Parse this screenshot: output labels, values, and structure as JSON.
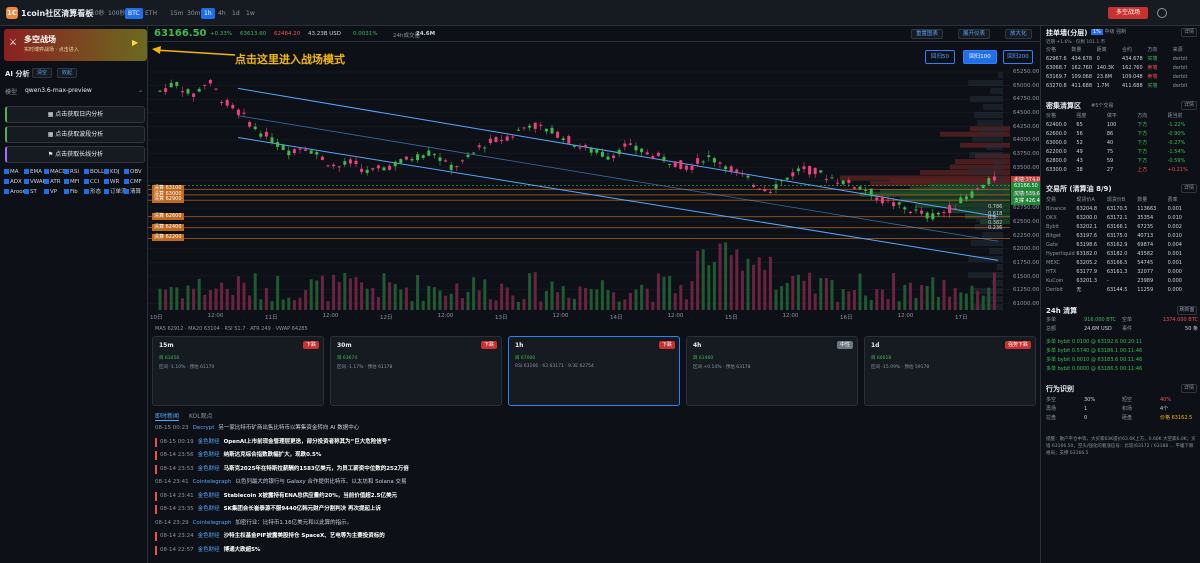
{
  "app": {
    "title": "1coin社区清算看板",
    "logo": "1C"
  },
  "topbar": {
    "tf": [
      "10秒",
      "100秒",
      "BTC",
      "ETH",
      "15m",
      "30m",
      "1h",
      "4h",
      "1d",
      "1w"
    ],
    "active": "BTC",
    "active2": "1h",
    "mode_label": "多空战场"
  },
  "left": {
    "battle_title": "多空战场",
    "battle_sub": "实时博弈战场 · 点击进入",
    "ai_title": "AI 分析",
    "clear": "清空",
    "collapse": "收起",
    "model_label": "模型",
    "model": "qwen3.6-max-preview",
    "actions": [
      "点击获取日内分析",
      "点击获取波段分析",
      "点击获取长线分析"
    ],
    "indicators": [
      "MA",
      "EMA",
      "MACD",
      "RSI",
      "BOLL",
      "KDJ",
      "OBV",
      "ADX",
      "VWAP",
      "ATR",
      "MFI",
      "CCI",
      "WR",
      "CMF",
      "Aroon",
      "ST",
      "VP",
      "Fib",
      "形态",
      "订单流",
      "清算"
    ]
  },
  "price": {
    "last": "63166.50",
    "change": "+0.33%",
    "high": "63613.60",
    "low": "62484.20",
    "vol": "43.23B USD",
    "funding": "0.0031%",
    "oi_label": "24h成交量",
    "oi": "24.6M",
    "btn_reset": "重置图表",
    "btn_expand": "展开仪表",
    "btn_full": "放大化"
  },
  "chart": {
    "annotation": "点击这里进入战场模式",
    "lookback": [
      "回归50",
      "回归100",
      "回归200"
    ],
    "lookback_active": "回归100",
    "y_ticks": [
      "65250.00",
      "65000.00",
      "64750.00",
      "64500.00",
      "64250.00",
      "64000.00",
      "63750.00",
      "63500.00",
      "63250.00",
      "63000.00",
      "62750.00",
      "62500.00",
      "62250.00",
      "62000.00",
      "61750.00",
      "61500.00",
      "61250.00",
      "61000.00"
    ],
    "x_ticks": [
      "10日",
      "12:00",
      "11日",
      "12:00",
      "12日",
      "12:00",
      "13日",
      "12:00",
      "14日",
      "12:00",
      "15日",
      "12:00",
      "16日",
      "12:00",
      "17日"
    ],
    "levels": [
      "清算 63100",
      "清算 63000",
      "清算 62900",
      "清算 62600",
      "清算 62400",
      "清算 62200"
    ],
    "right_labels": [
      {
        "t": "卖墙 374.068",
        "c": "#c93030"
      },
      {
        "t": "63166.50",
        "c": "#238636"
      },
      {
        "t": "买墙 539.638",
        "c": "#238636"
      },
      {
        "t": "支撑 426.498",
        "c": "#238636"
      }
    ],
    "fib": [
      "0.786",
      "0.618",
      "0.5",
      "0.382",
      "0.236"
    ]
  },
  "ind_line": "MA5 62912 · MA20 63104 · RSI 51.7 · ATR 249 · VWAP 64285",
  "tf_cards": [
    {
      "n": "15m",
      "badge": "下跌",
      "bc": "#c93030",
      "l1": "目 63450",
      "l2": "区间 -1.10% · 预估 61170"
    },
    {
      "n": "30m",
      "badge": "下跌",
      "bc": "#c93030",
      "l1": "目 63674",
      "l2": "区间 -1.17% · 预估 61178"
    },
    {
      "n": "1h",
      "badge": "下跌",
      "bc": "#c93030",
      "l1": "目 67000",
      "l2": "RSI 63166 · 63 63171 · 9.3E 62754"
    },
    {
      "n": "4h",
      "badge": "中性",
      "bc": "#6e7681",
      "l1": "目 61460",
      "l2": "区间 +0.14% · 预估 63178"
    },
    {
      "n": "1d",
      "badge": "强势下跌",
      "bc": "#c93030",
      "l1": "目 60018",
      "l2": "区间 -15.09% · 预估 59178"
    }
  ],
  "news_tabs": [
    "即时新闻",
    "KOL观点"
  ],
  "news": [
    {
      "t": "08-15 00:23",
      "s": "Decrypt",
      "x": "另一家比特币矿商出售比特币以筹集资金转向 AI 数据中心",
      "h": false
    },
    {
      "t": "08-15 00:19",
      "s": "金色财经",
      "x": "OpenAI上市前现金管理层更迭，部分投资者称其为“巨大危险信号”",
      "h": true
    },
    {
      "t": "08-14 23:56",
      "s": "金色财经",
      "x": "纳斯达克综合指数跌幅扩大，现跌0.5%",
      "h": true
    },
    {
      "t": "08-14 23:53",
      "s": "金色财经",
      "x": "马斯克2025年在特斯拉薪酬约1583亿美元，为员工薪资中位数的252万倍",
      "h": true
    },
    {
      "t": "08-14 23:41",
      "s": "Cointelegraph",
      "x": "以色列最大的银行与 Galaxy 合作提供比特币、以太坊和 Solana 交易",
      "h": false
    },
    {
      "t": "08-14 23:41",
      "s": "金色财经",
      "x": "Stablecoin X披露持有ENA总供应量约20%，当前价值超2.5亿美元",
      "h": true
    },
    {
      "t": "08-14 23:35",
      "s": "金色财经",
      "x": "SK集团会长崔泰源不服9440亿韩元财产分割判决 再次提起上诉",
      "h": true
    },
    {
      "t": "08-14 23:29",
      "s": "Cointelegraph",
      "x": "加密行业：比特币1.16亿美元和以此算的指示。",
      "h": false
    },
    {
      "t": "08-14 23:24",
      "s": "金色财经",
      "x": "沙特主权基金PIF披露美股持仓 SpaceX、艺电等为主要投资标的",
      "h": true
    },
    {
      "t": "08-14 22:57",
      "s": "金色财经",
      "x": "博通大跌超5%",
      "h": true
    }
  ],
  "right": {
    "funding_title": "挂单墙(分层)",
    "ft_tabs": [
      "1%",
      "中级",
      "强制"
    ],
    "funding_note": "近期 +1.6% · 仅剩 101.1 币",
    "ftable_head": [
      "价格",
      "数量",
      "距离",
      "合约",
      "方向",
      "来源"
    ],
    "ftable": [
      [
        "62967.6",
        "434.678",
        "0",
        "434.678",
        "买墙",
        "derbit"
      ],
      [
        "63068.7",
        "162.760",
        "140.3K",
        "162.760",
        "卖墙",
        "derbit"
      ],
      [
        "63169.7",
        "109.068",
        "23.8M",
        "109.048",
        "卖墙",
        "derbit"
      ],
      [
        "63270.8",
        "411.688",
        "1.7M",
        "411.688",
        "买墙",
        "derbit"
      ]
    ],
    "liq_title": "密集清算区",
    "liq_note": "#5个交易",
    "detail": "详情",
    "liq_head": [
      "价格",
      "强度",
      "做平",
      "方向",
      "距当前"
    ],
    "liq": [
      [
        "62400.0",
        "65",
        "100",
        "下方",
        "-1.22%"
      ],
      [
        "62600.0",
        "56",
        "86",
        "下方",
        "-0.90%"
      ],
      [
        "63000.0",
        "52",
        "40",
        "下方",
        "-0.27%"
      ],
      [
        "62200.0",
        "49",
        "75",
        "下方",
        "-1.54%"
      ],
      [
        "62800.0",
        "43",
        "59",
        "下方",
        "-0.59%"
      ],
      [
        "63300.0",
        "38",
        "27",
        "上方",
        "+0.21%"
      ]
    ],
    "ex_title": "交易所 (清算油 8/9)",
    "ex_head": [
      "交易",
      "现货价A",
      "现货价B",
      "数量",
      "费率"
    ],
    "ex": [
      [
        "Binance",
        "63204.8",
        "63170.5",
        "113663",
        "0.001"
      ],
      [
        "OKX",
        "63200.0",
        "63172.1",
        "35354",
        "0.010"
      ],
      [
        "Bybit",
        "63202.1",
        "63166.1",
        "67235",
        "0.002"
      ],
      [
        "Bitget",
        "63197.6",
        "63175.0",
        "40713",
        "0.010"
      ],
      [
        "Gate",
        "63198.6",
        "63162.9",
        "69874",
        "0.004"
      ],
      [
        "Hyperliquid",
        "63182.0",
        "63182.0",
        "43582",
        "0.001"
      ],
      [
        "MEXC",
        "63205.2",
        "63166.5",
        "54745",
        "0.001"
      ],
      [
        "HTX",
        "63177.9",
        "63161.3",
        "32077",
        "0.000"
      ],
      [
        "KuCoin",
        "63201.3",
        "-",
        "23989",
        "0.000"
      ],
      [
        "Deribit",
        "无",
        "63144.5",
        "11259",
        "0.000"
      ]
    ],
    "l24_title": "24h 清算",
    "l24_btn": "刷新面",
    "l24_row1": [
      "多单",
      "916.000 BTC",
      "空单",
      "1374.000 BTC"
    ],
    "l24_row2": [
      "总额",
      "24.6M USD",
      "事件",
      "50 条"
    ],
    "l24_items": [
      "多单 bybit 0.0100 @ 63192.6 00:20:11",
      "多单 bybit 0.5740 @ 63186.1 00:11:46",
      "多单 bybit 0.0010 @ 63183.6 00:11:46",
      "多单 bybit 0.0000 @ 63186.5 00:11:46"
    ],
    "beh_title": "行为识别",
    "beh_btn": "详情",
    "beh_rows": [
      [
        "多空",
        "30%",
        "短空",
        "40%"
      ],
      [
        "再场",
        "1",
        "积场",
        "4个"
      ],
      [
        "拉盘",
        "0",
        "砸盘",
        "价格 63162.5"
      ]
    ],
    "beh_note": "提醒：散户平仓中等，大买家63K提价63.6K上方，0.60K 大空家6.0K；买墙 63166.50，空头/强化的看涨信号：比较(63172 / 63188 … 平缓下跌格局；支撑 63166.5"
  }
}
